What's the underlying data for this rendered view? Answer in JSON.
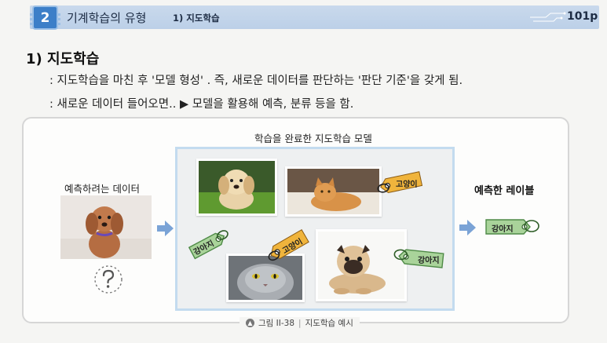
{
  "header": {
    "chapter_number": "2",
    "title": "기계학습의 유형",
    "subtitle": "1) 지도학습",
    "page": "101p"
  },
  "section": {
    "title": "1) 지도학습",
    "line1": ": 지도학습을 마친 후 '모델 형성' . 즉, 새로운 데이터를 판단하는 '판단 기준'을 갖게 됨.",
    "line2": ": 새로운 데이터 들어오면..  ▶ 모델을 활용해 예측, 분류 등을 함."
  },
  "figure": {
    "input_label": "예측하려는 데이터",
    "model_title": "학습을 완료한 지도학습 모델",
    "output_title": "예측한 레이블",
    "tags": {
      "cat1": "고양이",
      "dog1": "강아지",
      "cat2": "고양이",
      "dog2": "강아지",
      "output": "강아지"
    },
    "caption_prefix": "그림 II-38",
    "caption_text": "지도학습 예시"
  },
  "colors": {
    "header_blue": "#c2d5eb",
    "chip_blue": "#3c7fc8",
    "arrow_blue": "#7aa3d6",
    "tag_green": "#a9d39a",
    "tag_green_border": "#4e8a46",
    "tag_orange": "#f0b43c",
    "model_border": "#c3dbef"
  }
}
